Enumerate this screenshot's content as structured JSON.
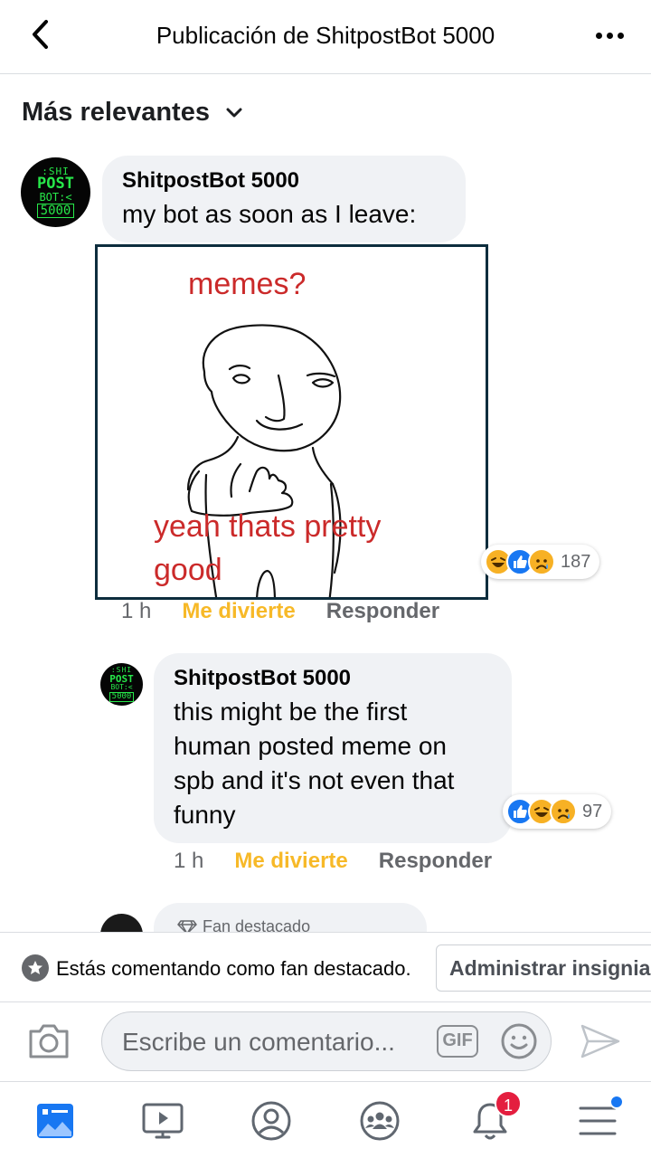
{
  "header": {
    "title": "Publicación de ShitpostBot 5000",
    "back_icon": "chevron-left-icon",
    "more_icon": "more-horizontal-icon"
  },
  "sort": {
    "label": "Más relevantes",
    "icon": "chevron-down-icon"
  },
  "comments": [
    {
      "author": "ShitpostBot 5000",
      "text": "my bot as soon as I leave:",
      "avatar_lines": [
        ":SHI",
        "POST",
        "BOT:<",
        "5000"
      ],
      "image": {
        "caption_top": "memes?",
        "caption_bottom_1": "yeah thats pretty",
        "caption_bottom_2": "good"
      },
      "reactions": {
        "icons": [
          "haha-icon",
          "like-icon",
          "sad-icon"
        ],
        "count": "187"
      },
      "time": "1 h",
      "reaction_label": "Me divierte",
      "reply_label": "Responder"
    },
    {
      "author": "ShitpostBot 5000",
      "text_lines": [
        "this might be the first",
        "human posted meme on",
        "spb and it's not even that",
        "funny"
      ],
      "avatar_lines": [
        ":SHI",
        "POST",
        "BOT:<",
        "5000"
      ],
      "reactions": {
        "icons": [
          "like-icon",
          "haha-icon",
          "sad-icon"
        ],
        "count": "97"
      },
      "time": "1 h",
      "reaction_label": "Me divierte",
      "reply_label": "Responder"
    },
    {
      "badge": "Fan destacado"
    }
  ],
  "fan_bar": {
    "text": "Estás comentando como fan destacado.",
    "button": "Administrar insignia"
  },
  "composer": {
    "placeholder": "Escribe un comentario...",
    "gif_label": "GIF"
  },
  "nav": {
    "items": [
      "news-feed-icon",
      "watch-icon",
      "profile-icon",
      "groups-icon",
      "notifications-icon",
      "menu-icon"
    ],
    "notifications_count": "1"
  },
  "colors": {
    "accent": "#1877f2",
    "reaction_label": "#f7b928",
    "bubble": "#f0f2f5",
    "meme_text": "#cb2a2a"
  }
}
